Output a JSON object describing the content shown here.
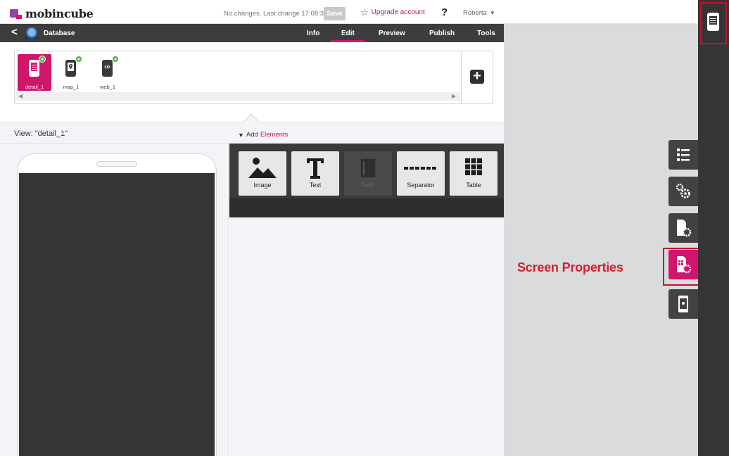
{
  "topbar": {
    "logo_text": "mobincube",
    "status": "No changes. Last change 17:08:32",
    "save_label": "Save",
    "upgrade_label": "Upgrade account",
    "help_label": "?",
    "user_name": "Roberta"
  },
  "navbar": {
    "app_name": "Database",
    "tabs": [
      {
        "label": "Info"
      },
      {
        "label": "Edit",
        "active": true
      },
      {
        "label": "Preview"
      },
      {
        "label": "Publish"
      },
      {
        "label": "Tools"
      }
    ]
  },
  "screens": {
    "items": [
      {
        "label": "detail_1",
        "icon": "screen-icon",
        "selected": true
      },
      {
        "label": "map_1",
        "icon": "map-screen-icon",
        "selected": false
      },
      {
        "label": "web_1",
        "icon": "web-screen-icon",
        "selected": false
      }
    ],
    "add_label": "+"
  },
  "view": {
    "label": "View: \"detail_1\"",
    "add_prefix": "Add",
    "add_elements": "Elements"
  },
  "elements": [
    {
      "label": "Image",
      "icon": "image-icon",
      "enabled": true
    },
    {
      "label": "Text",
      "icon": "text-icon",
      "enabled": true
    },
    {
      "label": "Field",
      "icon": "field-icon",
      "enabled": false
    },
    {
      "label": "Separator",
      "icon": "separator-icon",
      "enabled": true
    },
    {
      "label": "Table",
      "icon": "table-icon",
      "enabled": true
    }
  ],
  "side_tools": [
    {
      "icon": "list-icon"
    },
    {
      "icon": "settings-icon"
    },
    {
      "icon": "page-settings-icon"
    },
    {
      "icon": "screen-properties-icon",
      "active": true
    },
    {
      "icon": "device-location-icon"
    }
  ],
  "annotation": {
    "text": "Screen Properties",
    "color": "#d81e2b"
  },
  "colors": {
    "accent": "#d1156b",
    "dark_bar": "#3d3d3d",
    "workspace": "#dadbdd"
  }
}
